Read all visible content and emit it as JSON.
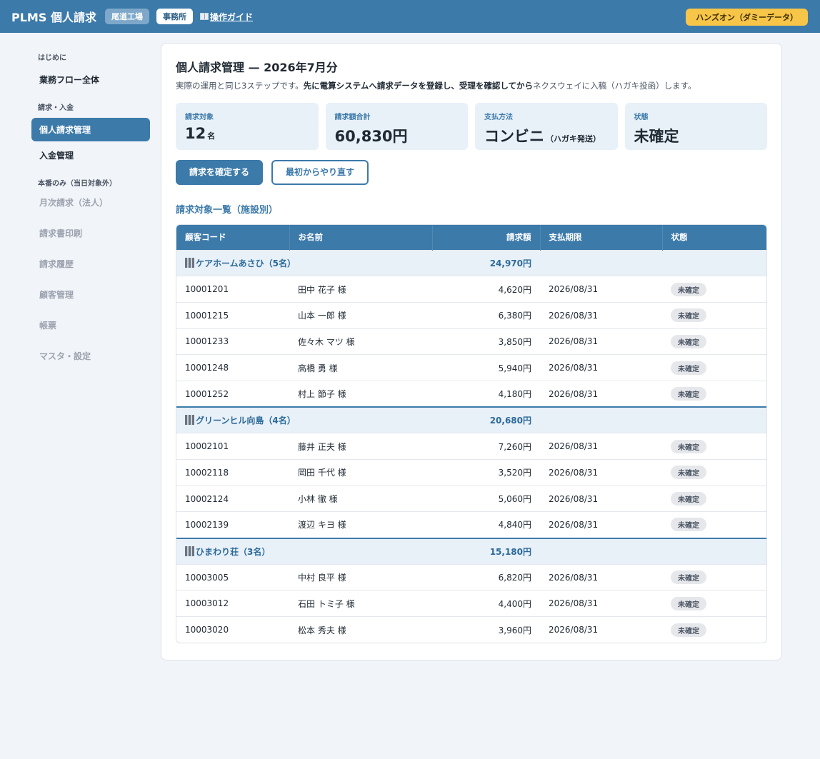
{
  "header": {
    "app_title": "PLMS 個人請求",
    "factory_chip": "尾道工場",
    "office_chip": "事務所",
    "guide_icon": "book-icon",
    "guide_link": "操作ガイド",
    "demo_badge": "ハンズオン（ダミーデータ）"
  },
  "sidebar": {
    "section_intro": "はじめに",
    "item_flow": "業務フロー全体",
    "section_billing": "請求・入金",
    "item_personal": "個人請求管理",
    "item_payment": "入金管理",
    "section_prod": "本番のみ（当日対象外）",
    "disabled_items": [
      "月次請求（法人）",
      "請求書印刷",
      "請求履歴",
      "顧客管理",
      "帳票",
      "マスタ・設定"
    ]
  },
  "main": {
    "title": "個人請求管理 — 2026年7月分",
    "desc_pre": "実際の運用と同じ3ステップです。",
    "desc_bold": "先に電算システムへ請求データを登録し、受理を確認してから",
    "desc_post": "ネクスウェイに入稿（ハガキ投函）します。",
    "stats": {
      "target_label": "請求対象",
      "target_value": "12",
      "target_unit": "名",
      "total_label": "請求額合計",
      "total_value": "60,830円",
      "method_label": "支払方法",
      "method_value": "コンビニ",
      "method_note": "（ハガキ発送）",
      "status_label": "状態",
      "status_value": "未確定"
    },
    "confirm_button": "請求を確定する",
    "restart_button": "最初からやり直す",
    "section_title": "請求対象一覧（施設別）"
  },
  "table": {
    "headers": {
      "code": "顧客コード",
      "name": "お名前",
      "amount": "請求額",
      "due": "支払期限",
      "status": "状態"
    },
    "groups": [
      {
        "facility": "ケアホームあさひ（5名）",
        "subtotal": "24,970円",
        "rows": [
          {
            "code": "10001201",
            "name": "田中 花子 様",
            "amount": "4,620円",
            "due": "2026/08/31",
            "status": "未確定"
          },
          {
            "code": "10001215",
            "name": "山本 一郎 様",
            "amount": "6,380円",
            "due": "2026/08/31",
            "status": "未確定"
          },
          {
            "code": "10001233",
            "name": "佐々木 マツ 様",
            "amount": "3,850円",
            "due": "2026/08/31",
            "status": "未確定"
          },
          {
            "code": "10001248",
            "name": "高橋 勇 様",
            "amount": "5,940円",
            "due": "2026/08/31",
            "status": "未確定"
          },
          {
            "code": "10001252",
            "name": "村上 節子 様",
            "amount": "4,180円",
            "due": "2026/08/31",
            "status": "未確定"
          }
        ]
      },
      {
        "facility": "グリーンヒル向島（4名）",
        "subtotal": "20,680円",
        "rows": [
          {
            "code": "10002101",
            "name": "藤井 正夫 様",
            "amount": "7,260円",
            "due": "2026/08/31",
            "status": "未確定"
          },
          {
            "code": "10002118",
            "name": "岡田 千代 様",
            "amount": "3,520円",
            "due": "2026/08/31",
            "status": "未確定"
          },
          {
            "code": "10002124",
            "name": "小林 徹 様",
            "amount": "5,060円",
            "due": "2026/08/31",
            "status": "未確定"
          },
          {
            "code": "10002139",
            "name": "渡辺 キヨ 様",
            "amount": "4,840円",
            "due": "2026/08/31",
            "status": "未確定"
          }
        ]
      },
      {
        "facility": "ひまわり荘（3名）",
        "subtotal": "15,180円",
        "rows": [
          {
            "code": "10003005",
            "name": "中村 良平 様",
            "amount": "6,820円",
            "due": "2026/08/31",
            "status": "未確定"
          },
          {
            "code": "10003012",
            "name": "石田 トミ子 様",
            "amount": "4,400円",
            "due": "2026/08/31",
            "status": "未確定"
          },
          {
            "code": "10003020",
            "name": "松本 秀夫 様",
            "amount": "3,960円",
            "due": "2026/08/31",
            "status": "未確定"
          }
        ]
      }
    ]
  }
}
